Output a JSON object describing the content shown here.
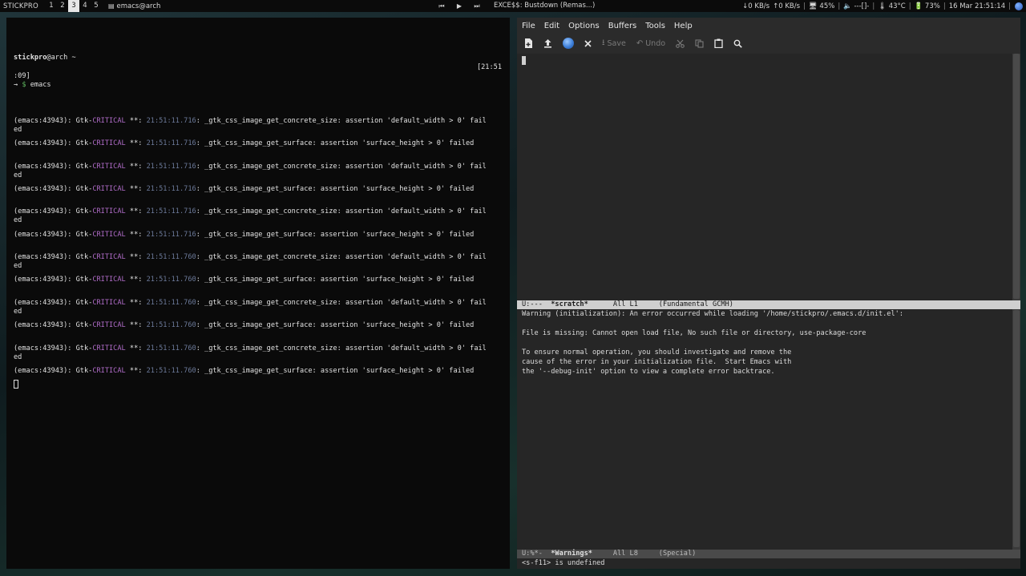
{
  "topbar": {
    "brand": "STICKPRO",
    "workspaces": [
      "1",
      "2",
      "3",
      "4",
      "5"
    ],
    "active_workspace": "3",
    "window_icon": "window-icon",
    "window_title": "emacs@arch",
    "media": {
      "prev": "⏮",
      "play": "▶",
      "next": "⏭"
    },
    "song": "EXCE$$: Bustdown (Remas...)",
    "net_down": "↓0 KB/s",
    "net_up": "↑0 KB/s",
    "sep": "|",
    "monitor_label": "🖥 45%",
    "volume": "🔈 ---[]-",
    "temp": "🌡 43°C",
    "battery": "🔋 73%",
    "datetime": "16 Mar 21:51:14"
  },
  "terminal": {
    "prompt_user": "stickpro",
    "prompt_host": "@arch ~",
    "prompt_time_a": "[21:51",
    "prompt_time_b": ":09]",
    "prompt_arrow": "→",
    "prompt_dollar": "$",
    "command": " emacs",
    "errors": [
      {
        "pid": "(emacs:43943): Gtk-",
        "level": "CRITICAL",
        "stars": " **: ",
        "time": "21:51:11.716",
        "msg": ": _gtk_css_image_get_concrete_size: assertion 'default_width > 0' fail",
        "wrap": "ed"
      },
      {
        "pid": "(emacs:43943): Gtk-",
        "level": "CRITICAL",
        "stars": " **: ",
        "time": "21:51:11.716",
        "msg": ": _gtk_css_image_get_surface: assertion 'surface_height > 0' failed",
        "wrap": ""
      },
      {
        "pid": "(emacs:43943): Gtk-",
        "level": "CRITICAL",
        "stars": " **: ",
        "time": "21:51:11.716",
        "msg": ": _gtk_css_image_get_concrete_size: assertion 'default_width > 0' fail",
        "wrap": "ed"
      },
      {
        "pid": "(emacs:43943): Gtk-",
        "level": "CRITICAL",
        "stars": " **: ",
        "time": "21:51:11.716",
        "msg": ": _gtk_css_image_get_surface: assertion 'surface_height > 0' failed",
        "wrap": ""
      },
      {
        "pid": "(emacs:43943): Gtk-",
        "level": "CRITICAL",
        "stars": " **: ",
        "time": "21:51:11.716",
        "msg": ": _gtk_css_image_get_concrete_size: assertion 'default_width > 0' fail",
        "wrap": "ed"
      },
      {
        "pid": "(emacs:43943): Gtk-",
        "level": "CRITICAL",
        "stars": " **: ",
        "time": "21:51:11.716",
        "msg": ": _gtk_css_image_get_surface: assertion 'surface_height > 0' failed",
        "wrap": ""
      },
      {
        "pid": "(emacs:43943): Gtk-",
        "level": "CRITICAL",
        "stars": " **: ",
        "time": "21:51:11.760",
        "msg": ": _gtk_css_image_get_concrete_size: assertion 'default_width > 0' fail",
        "wrap": "ed"
      },
      {
        "pid": "(emacs:43943): Gtk-",
        "level": "CRITICAL",
        "stars": " **: ",
        "time": "21:51:11.760",
        "msg": ": _gtk_css_image_get_surface: assertion 'surface_height > 0' failed",
        "wrap": ""
      },
      {
        "pid": "(emacs:43943): Gtk-",
        "level": "CRITICAL",
        "stars": " **: ",
        "time": "21:51:11.760",
        "msg": ": _gtk_css_image_get_concrete_size: assertion 'default_width > 0' fail",
        "wrap": "ed"
      },
      {
        "pid": "(emacs:43943): Gtk-",
        "level": "CRITICAL",
        "stars": " **: ",
        "time": "21:51:11.760",
        "msg": ": _gtk_css_image_get_surface: assertion 'surface_height > 0' failed",
        "wrap": ""
      },
      {
        "pid": "(emacs:43943): Gtk-",
        "level": "CRITICAL",
        "stars": " **: ",
        "time": "21:51:11.760",
        "msg": ": _gtk_css_image_get_concrete_size: assertion 'default_width > 0' fail",
        "wrap": "ed"
      },
      {
        "pid": "(emacs:43943): Gtk-",
        "level": "CRITICAL",
        "stars": " **: ",
        "time": "21:51:11.760",
        "msg": ": _gtk_css_image_get_surface: assertion 'surface_height > 0' failed",
        "wrap": ""
      }
    ]
  },
  "emacs": {
    "menu": [
      "File",
      "Edit",
      "Options",
      "Buffers",
      "Tools",
      "Help"
    ],
    "toolbar": {
      "new_icon": "new-file-icon",
      "open_icon": "open-file-icon",
      "dired_icon": "globe-icon",
      "close_icon": "close-icon",
      "save_label": "Save",
      "undo_label": "Undo",
      "cut_icon": "scissors-icon",
      "copy_icon": "copy-icon",
      "paste_icon": "paste-icon",
      "search_icon": "search-icon"
    },
    "modeline_top": {
      "state": "U:---  ",
      "buffer": "*scratch*",
      "position": "      All L1     ",
      "mode": "(Fundamental GCMH)"
    },
    "warnings": [
      "Warning (initialization): An error occurred while loading '/home/stickpro/.emacs.d/init.el':",
      "",
      "File is missing: Cannot open load file, No such file or directory, use-package-core",
      "",
      "To ensure normal operation, you should investigate and remove the",
      "cause of the error in your initialization file.  Start Emacs with",
      "the '--debug-init' option to view a complete error backtrace."
    ],
    "modeline_bottom": {
      "state": "U:%*-  ",
      "buffer": "*Warnings*",
      "position": "     All L8     ",
      "mode": "(Special)"
    },
    "minibuffer": "<s-f11> is undefined"
  }
}
